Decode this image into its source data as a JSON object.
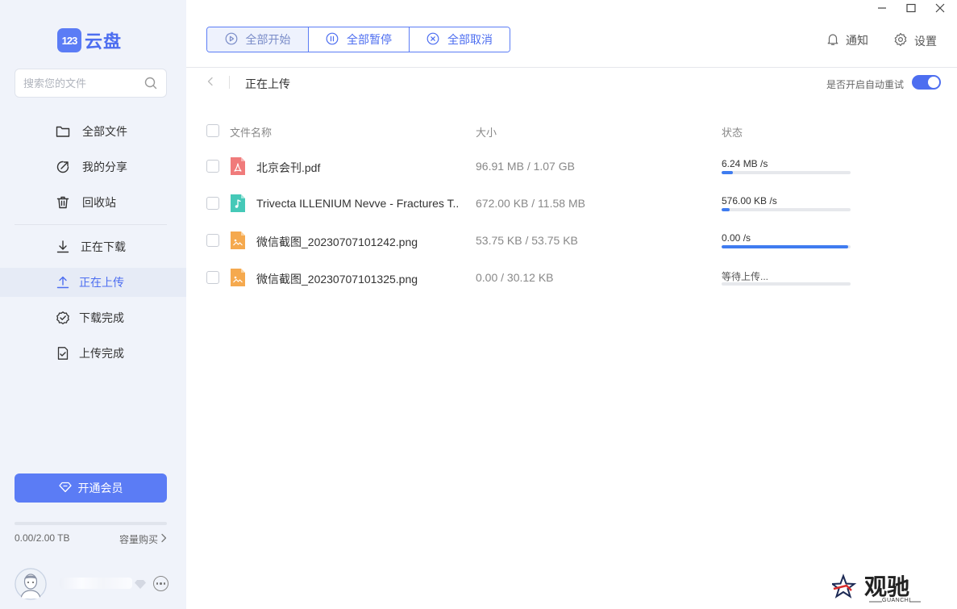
{
  "app": {
    "logo_badge": "123",
    "logo_text": "云盘"
  },
  "search": {
    "placeholder": "搜索您的文件"
  },
  "sidebar": {
    "items": [
      {
        "label": "全部文件",
        "icon": "folder-icon"
      },
      {
        "label": "我的分享",
        "icon": "share-icon"
      },
      {
        "label": "回收站",
        "icon": "trash-icon"
      },
      {
        "label": "正在下载",
        "icon": "download-icon"
      },
      {
        "label": "正在上传",
        "icon": "upload-icon",
        "active": true
      },
      {
        "label": "下载完成",
        "icon": "check-circle-icon"
      },
      {
        "label": "上传完成",
        "icon": "doc-check-icon"
      }
    ],
    "vip_button": "开通会员",
    "storage": {
      "used_text": "0.00/2.00 TB",
      "buy_label": "容量购买",
      "used_fraction": 0.0
    }
  },
  "toolbar": {
    "start_all": "全部开始",
    "pause_all": "全部暂停",
    "cancel_all": "全部取消",
    "notify": "通知",
    "settings": "设置"
  },
  "main": {
    "section_title": "正在上传",
    "auto_retry_label": "是否开启自动重试",
    "auto_retry_enabled": true,
    "columns": {
      "name": "文件名称",
      "size": "大小",
      "status": "状态"
    },
    "files": [
      {
        "name": "北京会刊.pdf",
        "type": "pdf",
        "size": "96.91 MB / 1.07 GB",
        "status": "6.24 MB /s",
        "progress": 0.09
      },
      {
        "name": "Trivecta ILLENIUM Nevve - Fractures T...",
        "type": "audio",
        "size": "672.00 KB / 11.58 MB",
        "status": "576.00 KB /s",
        "progress": 0.06
      },
      {
        "name": "微信截图_20230707101242.png",
        "type": "image",
        "size": "53.75 KB / 53.75 KB",
        "status": "0.00 /s",
        "progress": 0.98
      },
      {
        "name": "微信截图_20230707101325.png",
        "type": "image",
        "size": "0.00 / 30.12 KB",
        "status": "等待上传...",
        "progress": 0.0
      }
    ]
  },
  "colors": {
    "accent": "#4d6ef0",
    "sidebar_bg": "#f0f3fa",
    "progress": "#3f7cf0",
    "pdf": "#f07b7b",
    "audio": "#45c9b8",
    "image": "#f5a94e"
  },
  "watermark": {
    "text": "观驰",
    "sub": "GUANCHI"
  }
}
